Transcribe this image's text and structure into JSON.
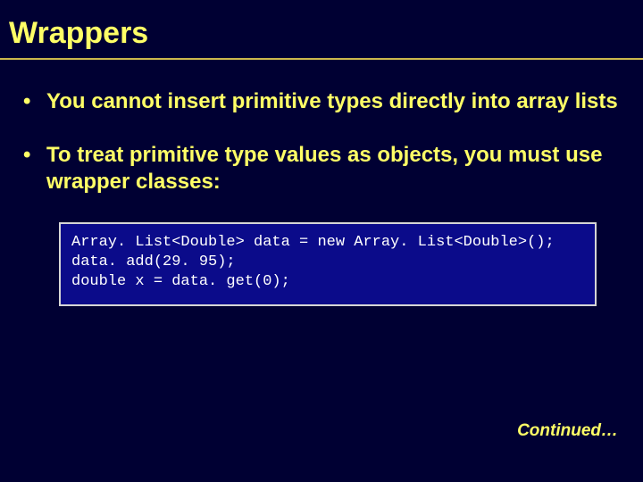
{
  "title": "Wrappers",
  "bullets": [
    "You cannot insert primitive types directly into array lists",
    "To treat primitive type values as objects, you must use wrapper classes:"
  ],
  "code": "Array. List<Double> data = new Array. List<Double>();\ndata. add(29. 95);\ndouble x = data. get(0);",
  "continued": "Continued…"
}
